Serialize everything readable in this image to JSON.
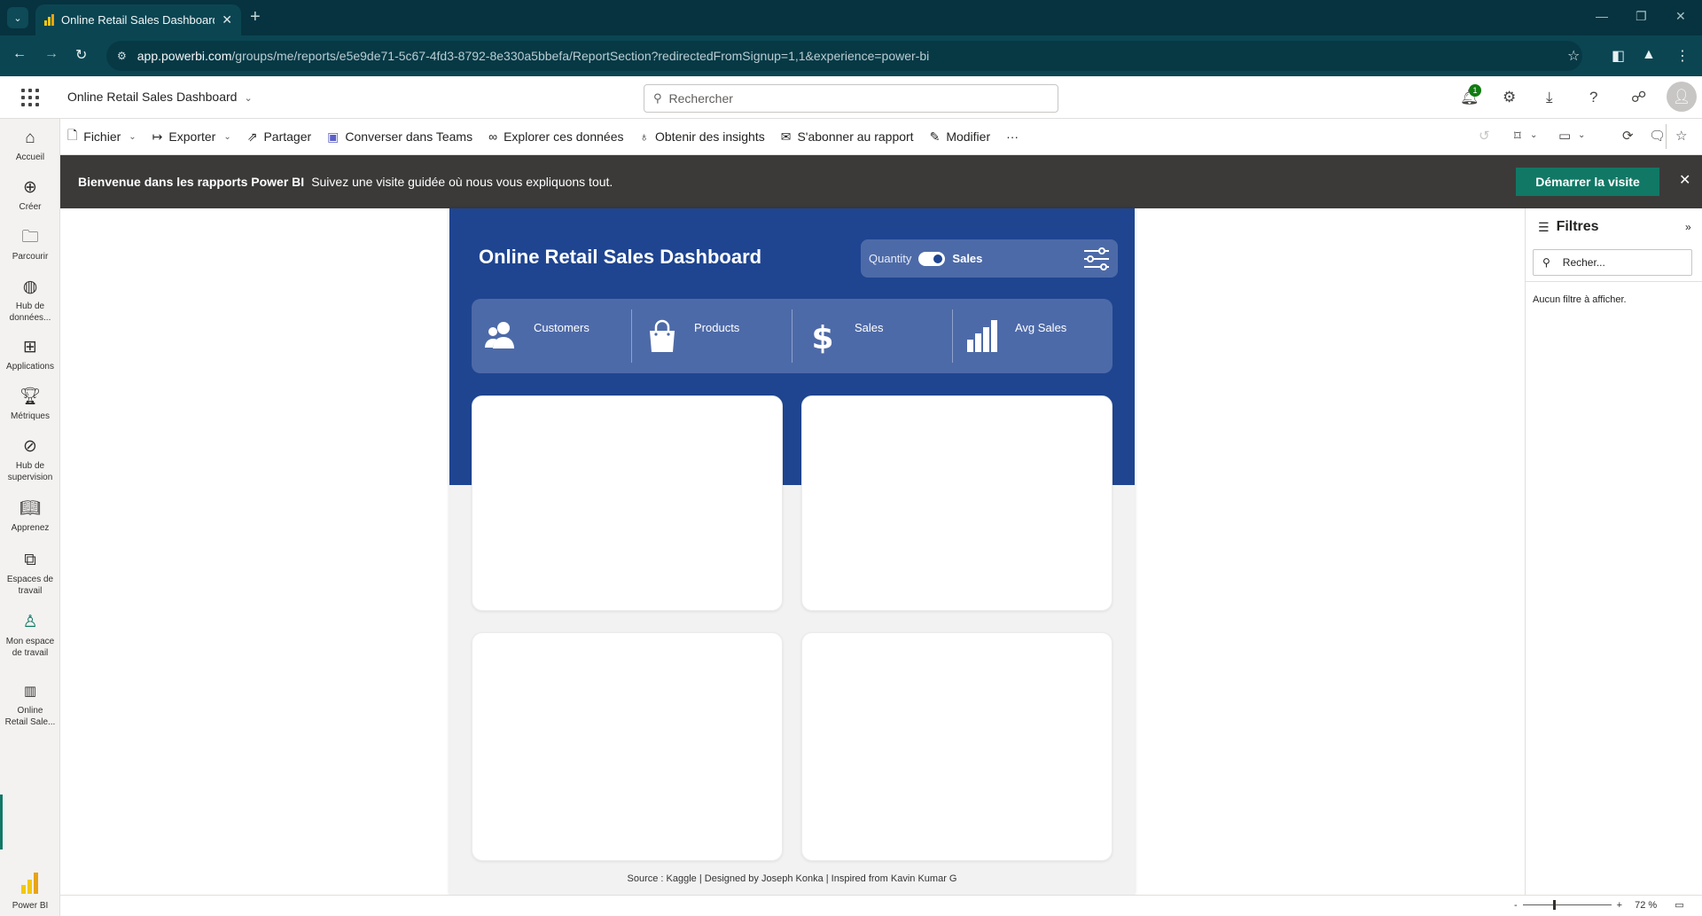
{
  "browser": {
    "tab_title": "Online Retail Sales Dashboard",
    "url_host": "app.powerbi.com",
    "url_path": "/groups/me/reports/e5e9de71-5c67-4fd3-8792-8e330a5bbefa/ReportSection?redirectedFromSignup=1,1&experience=power-bi"
  },
  "header": {
    "report_title": "Online Retail Sales Dashboard",
    "search_placeholder": "Rechercher",
    "notification_count": "1"
  },
  "toolbar": {
    "file": "Fichier",
    "export": "Exporter",
    "share": "Partager",
    "teams": "Converser dans Teams",
    "explore": "Explorer ces données",
    "insights": "Obtenir des insights",
    "subscribe": "S'abonner au rapport",
    "edit": "Modifier",
    "more": "···"
  },
  "banner": {
    "title": "Bienvenue dans les rapports Power BI",
    "text": "Suivez une visite guidée où nous vous expliquons tout.",
    "button": "Démarrer la visite"
  },
  "sidebar": {
    "items": [
      {
        "label1": "Accueil",
        "label2": ""
      },
      {
        "label1": "Créer",
        "label2": ""
      },
      {
        "label1": "Parcourir",
        "label2": ""
      },
      {
        "label1": "Hub de",
        "label2": "données..."
      },
      {
        "label1": "Applications",
        "label2": ""
      },
      {
        "label1": "Métriques",
        "label2": ""
      },
      {
        "label1": "Hub de",
        "label2": "supervision"
      },
      {
        "label1": "Apprenez",
        "label2": ""
      },
      {
        "label1": "Espaces de",
        "label2": "travail"
      },
      {
        "label1": "Mon espace",
        "label2": "de travail"
      },
      {
        "label1": "Online",
        "label2": "Retail Sale..."
      }
    ],
    "brand": "Power BI"
  },
  "report": {
    "title": "Online Retail Sales Dashboard",
    "toggle_left": "Quantity",
    "toggle_right": "Sales",
    "kpis": [
      "Customers",
      "Products",
      "Sales",
      "Avg Sales"
    ],
    "source": "Source : Kaggle |  Designed by Joseph Konka | Inspired from Kavin Kumar G"
  },
  "filters": {
    "title": "Filtres",
    "search_placeholder": "Recher...",
    "empty_text": "Aucun filtre à afficher."
  },
  "status": {
    "zoom": "72 %"
  },
  "colors": {
    "banner_blue": "#1f4591",
    "kpi_blue": "#4d6aa8",
    "accent_green": "#117865"
  }
}
